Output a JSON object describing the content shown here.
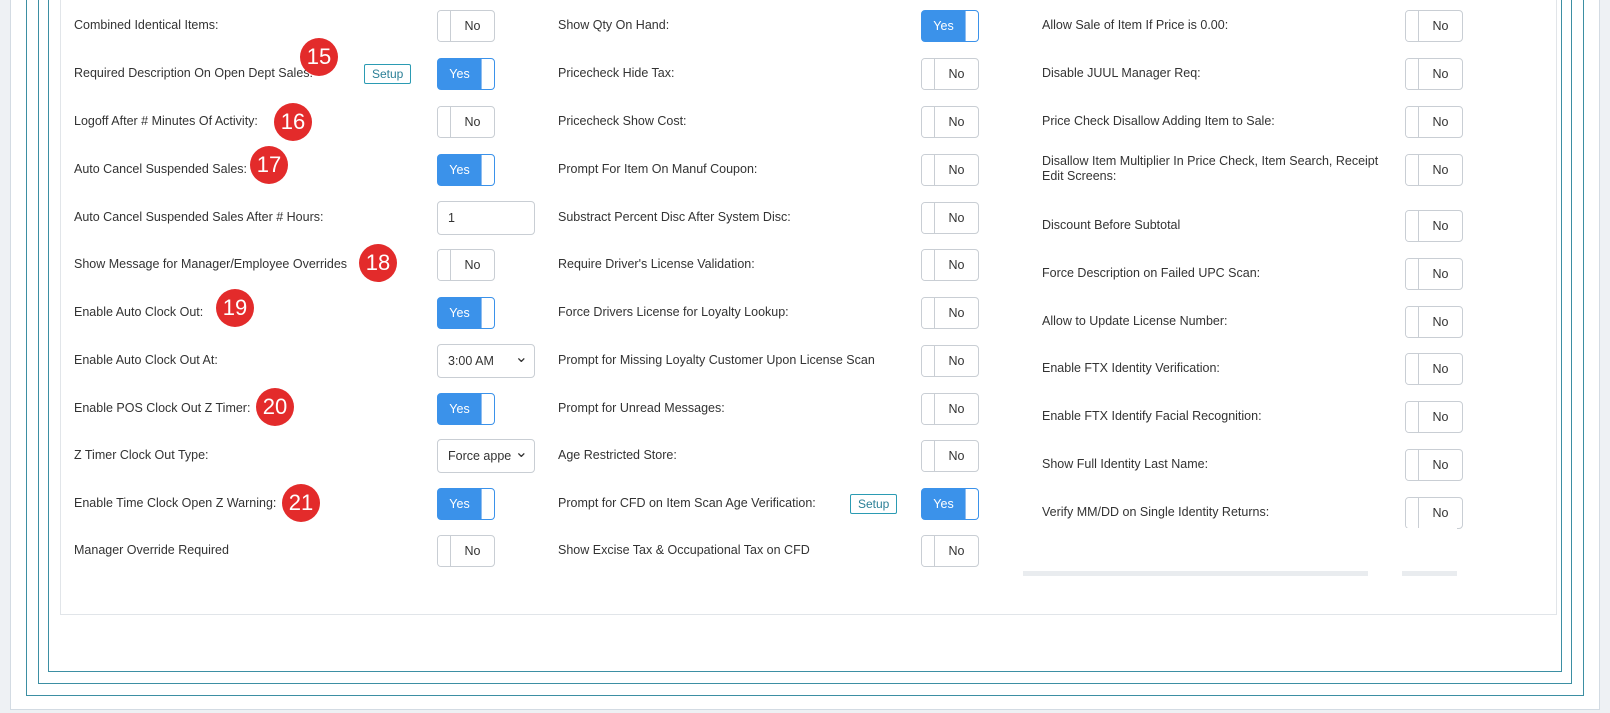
{
  "col1": [
    {
      "label": "Combined Identical Items:",
      "control": "toggle",
      "value": "No"
    },
    {
      "label": "Required Description On Open Dept Sales:",
      "control": "toggle",
      "value": "Yes",
      "setup": "Setup",
      "badge": "15"
    },
    {
      "label": "Logoff After # Minutes Of Activity:",
      "control": "toggle",
      "value": "No",
      "badge": "16"
    },
    {
      "label": "Auto Cancel Suspended Sales:",
      "control": "toggle",
      "value": "Yes",
      "badge": "17"
    },
    {
      "label": "Auto Cancel Suspended Sales After # Hours:",
      "control": "input",
      "value": "1"
    },
    {
      "label": "Show Message for Manager/Employee Overrides",
      "control": "toggle",
      "value": "No",
      "badge": "18"
    },
    {
      "label": "Enable Auto Clock Out:",
      "control": "toggle",
      "value": "Yes",
      "badge": "19"
    },
    {
      "label": "Enable Auto Clock Out At:",
      "control": "select",
      "value": "3:00 AM"
    },
    {
      "label": "Enable POS Clock Out Z Timer:",
      "control": "toggle",
      "value": "Yes",
      "badge": "20"
    },
    {
      "label": "Z Timer Clock Out Type:",
      "control": "select",
      "value": "Force appe"
    },
    {
      "label": "Enable Time Clock Open Z Warning:",
      "control": "toggle",
      "value": "Yes",
      "badge": "21"
    },
    {
      "label": "Manager Override Required",
      "control": "toggle",
      "value": "No"
    }
  ],
  "col2": [
    {
      "label": "Show Qty On Hand:",
      "control": "toggle",
      "value": "Yes"
    },
    {
      "label": "Pricecheck Hide Tax:",
      "control": "toggle",
      "value": "No"
    },
    {
      "label": "Pricecheck Show Cost:",
      "control": "toggle",
      "value": "No"
    },
    {
      "label": "Prompt For Item On Manuf Coupon:",
      "control": "toggle",
      "value": "No"
    },
    {
      "label": "Substract Percent Disc After System Disc:",
      "control": "toggle",
      "value": "No"
    },
    {
      "label": "Require Driver's License Validation:",
      "control": "toggle",
      "value": "No"
    },
    {
      "label": "Force Drivers License for Loyalty Lookup:",
      "control": "toggle",
      "value": "No"
    },
    {
      "label": "Prompt for Missing Loyalty Customer Upon License Scan",
      "control": "toggle",
      "value": "No"
    },
    {
      "label": "Prompt for Unread Messages:",
      "control": "toggle",
      "value": "No"
    },
    {
      "label": "Age Restricted Store:",
      "control": "toggle",
      "value": "No"
    },
    {
      "label": "Prompt for CFD on Item Scan Age Verification:",
      "control": "toggle",
      "value": "Yes",
      "setup": "Setup"
    },
    {
      "label": "Show Excise Tax & Occupational Tax on CFD",
      "control": "toggle",
      "value": "No"
    }
  ],
  "col3": [
    {
      "label": "Allow Sale of Item If Price is 0.00:",
      "control": "toggle",
      "value": "No"
    },
    {
      "label": "Disable JUUL Manager Req:",
      "control": "toggle",
      "value": "No"
    },
    {
      "label": "Price Check Disallow Adding Item to Sale:",
      "control": "toggle",
      "value": "No"
    },
    {
      "label": "Disallow Item Multiplier In Price Check, Item Search, Receipt Edit Screens:",
      "control": "toggle",
      "value": "No"
    },
    {
      "label": "Discount Before Subtotal",
      "control": "toggle",
      "value": "No"
    },
    {
      "label": "Force Description on Failed UPC Scan:",
      "control": "toggle",
      "value": "No"
    },
    {
      "label": "Allow to Update License Number:",
      "control": "toggle",
      "value": "No"
    },
    {
      "label": "Enable FTX Identity Verification:",
      "control": "toggle",
      "value": "No"
    },
    {
      "label": "Enable FTX Identify Facial Recognition:",
      "control": "toggle",
      "value": "No"
    },
    {
      "label": "Show Full Identity Last Name:",
      "control": "toggle",
      "value": "No"
    },
    {
      "label": "Verify MM/DD on Single Identity Returns:",
      "control": "toggle",
      "value": "No"
    }
  ],
  "colors": {
    "accent": "#3b92ea",
    "badge": "#e32b2b",
    "frame": "#3d8fa3",
    "setup": "#2b9bb3"
  }
}
